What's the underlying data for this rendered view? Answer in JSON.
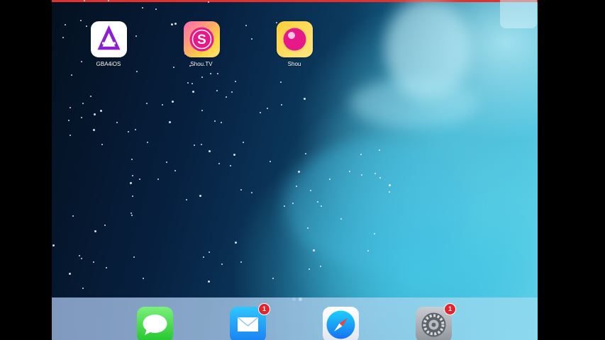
{
  "home_screen": {
    "apps": [
      {
        "id": "gba4ios",
        "label": "GBA4iOS",
        "icon": "gba4ios-triangle-icon"
      },
      {
        "id": "shoutv",
        "label": "Shou.TV",
        "icon": "shoutv-s-icon"
      },
      {
        "id": "shou",
        "label": "Shou",
        "icon": "shou-record-icon"
      }
    ],
    "page_indicator": {
      "pages": 2,
      "current": 2
    }
  },
  "dock": {
    "apps": [
      {
        "id": "messages",
        "icon": "messages-icon",
        "badge": ""
      },
      {
        "id": "mail",
        "icon": "mail-icon",
        "badge": "1"
      },
      {
        "id": "safari",
        "icon": "safari-compass-icon",
        "badge": ""
      },
      {
        "id": "settings",
        "icon": "settings-gear-icon",
        "badge": "1"
      }
    ]
  },
  "colors": {
    "recording_bar": "#e0312f",
    "badge": "#e3242b",
    "gba_purple": "#8b1fd6",
    "shou_pink": "#e6188a"
  }
}
